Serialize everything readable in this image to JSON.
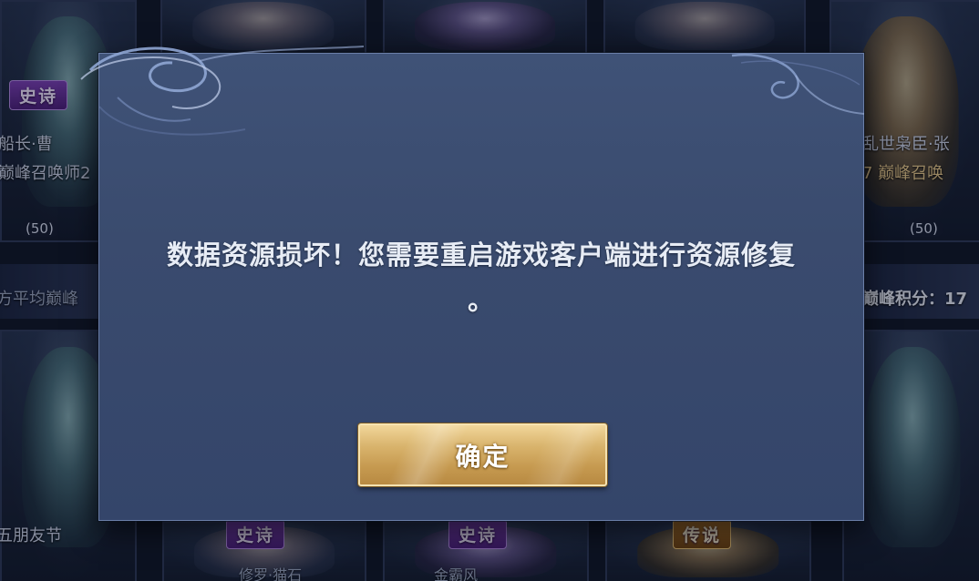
{
  "dialog": {
    "message": "数据资源损坏！您需要重启游戏客户端进行资源修复",
    "message_tail": "。",
    "confirm_label": "确定"
  },
  "background": {
    "badges": {
      "epic": "史诗",
      "legend": "传说"
    },
    "left_column": {
      "name_1": "船长·曹",
      "player_1": "巅峰召唤师2",
      "level_1": "(50)",
      "rank_text": "方平均巅峰",
      "event_text": "五朋友节"
    },
    "right_column": {
      "name_1": "乱世枭臣·张",
      "player_1": "7 巅峰召唤",
      "level_1": "(50)",
      "score_text": "巅峰积分：17"
    },
    "bottom_row": {
      "skin_2": "修罗·猫石",
      "skin_3": "金霸风"
    }
  },
  "colors": {
    "dialog_bg": "#3a4b6e",
    "dialog_border": "#6b7fa8",
    "button_gold": "#d9b46d",
    "message_text": "#e7ecf5",
    "epic_purple": "#7a3fb5",
    "legend_orange": "#b77a2c"
  },
  "icons": {
    "dialog_ornament": "cloud-swirl-icon"
  }
}
